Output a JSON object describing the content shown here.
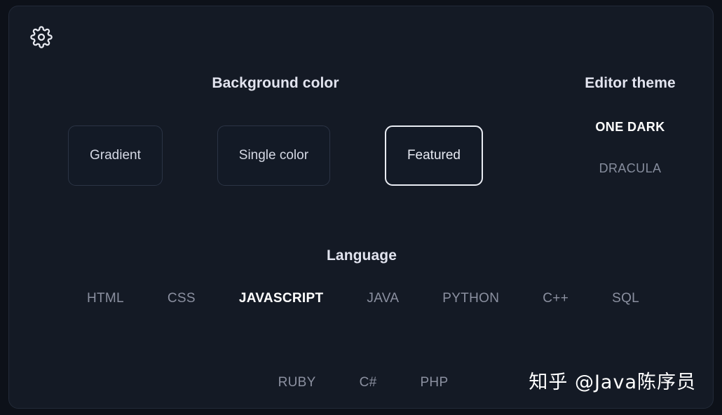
{
  "panel": {
    "gear_icon": "gear-icon"
  },
  "background": {
    "heading": "Background color",
    "options": [
      {
        "label": "Gradient",
        "selected": false
      },
      {
        "label": "Single color",
        "selected": false
      },
      {
        "label": "Featured",
        "selected": true
      }
    ]
  },
  "editor_theme": {
    "heading": "Editor theme",
    "options": [
      {
        "label": "ONE DARK",
        "selected": true
      },
      {
        "label": "DRACULA",
        "selected": false
      }
    ]
  },
  "language": {
    "heading": "Language",
    "options": [
      {
        "label": "HTML",
        "selected": false
      },
      {
        "label": "CSS",
        "selected": false
      },
      {
        "label": "JAVASCRIPT",
        "selected": true
      },
      {
        "label": "JAVA",
        "selected": false
      },
      {
        "label": "PYTHON",
        "selected": false
      },
      {
        "label": "C++",
        "selected": false
      },
      {
        "label": "SQL",
        "selected": false
      },
      {
        "label": "RUBY",
        "selected": false
      },
      {
        "label": "C#",
        "selected": false
      },
      {
        "label": "PHP",
        "selected": false
      }
    ],
    "row_break_after_index": 6
  },
  "watermark": {
    "text": "知乎 @Java陈序员"
  },
  "colors": {
    "page_background": "#0d1119",
    "panel_background": "#141a25",
    "panel_border": "#222a38",
    "selected_border": "#e9ecf3",
    "unselected_border": "#2b3445",
    "heading_text": "#e2e4ef",
    "muted_text": "#8b90a0",
    "selected_text": "#ffffff"
  }
}
